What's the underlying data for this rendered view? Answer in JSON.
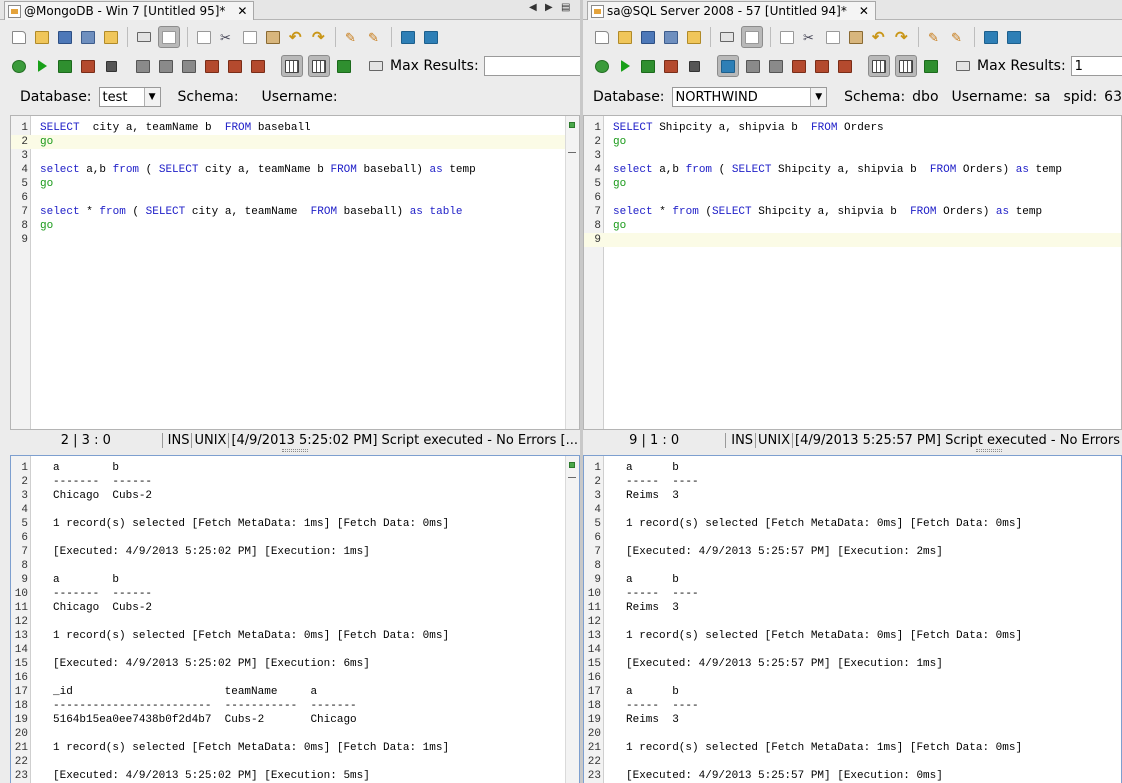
{
  "left": {
    "tab_title": "@MongoDB - Win 7 [Untitled 95]*",
    "tab_close": "✕",
    "max_results_label": "Max Results:",
    "max_results_value": "",
    "database_label": "Database:",
    "database_value": "test",
    "schema_label": "Schema:",
    "username_label": "Username:",
    "editor_lines": [
      {
        "n": "1",
        "parts": [
          [
            "kw",
            "SELECT"
          ],
          [
            "",
            "  city a, teamName b  "
          ],
          [
            "kw",
            "FROM"
          ],
          [
            "",
            " baseball"
          ]
        ]
      },
      {
        "n": "2",
        "parts": [
          [
            "go",
            "go"
          ]
        ]
      },
      {
        "n": "3",
        "parts": []
      },
      {
        "n": "4",
        "parts": [
          [
            "kw",
            "select"
          ],
          [
            "",
            " a,b "
          ],
          [
            "kw",
            "from"
          ],
          [
            "",
            " ( "
          ],
          [
            "kw",
            "SELECT"
          ],
          [
            "",
            " city a, teamName b "
          ],
          [
            "kw",
            "FROM"
          ],
          [
            "",
            " baseball) "
          ],
          [
            "kw",
            "as"
          ],
          [
            "",
            " temp"
          ]
        ]
      },
      {
        "n": "5",
        "parts": [
          [
            "go",
            "go"
          ]
        ]
      },
      {
        "n": "6",
        "parts": []
      },
      {
        "n": "7",
        "parts": [
          [
            "kw",
            "select"
          ],
          [
            "",
            " * "
          ],
          [
            "kw",
            "from"
          ],
          [
            "",
            " ( "
          ],
          [
            "kw",
            "SELECT"
          ],
          [
            "",
            " city a, teamName  "
          ],
          [
            "kw",
            "FROM"
          ],
          [
            "",
            " baseball) "
          ],
          [
            "kw",
            "as"
          ],
          [
            "",
            " "
          ],
          [
            "kw",
            "table"
          ]
        ]
      },
      {
        "n": "8",
        "parts": [
          [
            "go",
            "go"
          ]
        ]
      },
      {
        "n": "9",
        "parts": []
      }
    ],
    "status_pos": "2 | 3 : 0",
    "status_ins": "INS",
    "status_unix": "UNIX",
    "status_msg": "[4/9/2013 5:25:02 PM] Script executed - No Errors [...",
    "output_lines": [
      [
        "1",
        "a        b"
      ],
      [
        "2",
        "-------  ------"
      ],
      [
        "3",
        "Chicago  Cubs-2"
      ],
      [
        "4",
        ""
      ],
      [
        "5",
        "1 record(s) selected [Fetch MetaData: 1ms] [Fetch Data: 0ms]"
      ],
      [
        "6",
        ""
      ],
      [
        "7",
        "[Executed: 4/9/2013 5:25:02 PM] [Execution: 1ms]"
      ],
      [
        "8",
        ""
      ],
      [
        "9",
        "a        b"
      ],
      [
        "10",
        "-------  ------"
      ],
      [
        "11",
        "Chicago  Cubs-2"
      ],
      [
        "12",
        ""
      ],
      [
        "13",
        "1 record(s) selected [Fetch MetaData: 0ms] [Fetch Data: 0ms]"
      ],
      [
        "14",
        ""
      ],
      [
        "15",
        "[Executed: 4/9/2013 5:25:02 PM] [Execution: 6ms]"
      ],
      [
        "16",
        ""
      ],
      [
        "17",
        "_id                       teamName     a"
      ],
      [
        "18",
        "------------------------  -----------  -------"
      ],
      [
        "19",
        "5164b15ea0ee7438b0f2d4b7  Cubs-2       Chicago"
      ],
      [
        "20",
        ""
      ],
      [
        "21",
        "1 record(s) selected [Fetch MetaData: 0ms] [Fetch Data: 1ms]"
      ],
      [
        "22",
        ""
      ],
      [
        "23",
        "[Executed: 4/9/2013 5:25:02 PM] [Execution: 5ms]"
      ],
      [
        "24",
        ""
      ]
    ]
  },
  "right": {
    "tab_title": "sa@SQL Server 2008 - 57 [Untitled 94]*",
    "tab_close": "✕",
    "max_results_label": "Max Results:",
    "max_results_value": "1",
    "database_label": "Database:",
    "database_value": "NORTHWIND",
    "schema_label": "Schema:",
    "schema_value": "dbo",
    "username_label": "Username:",
    "username_value": "sa",
    "spid_label": "spid:",
    "spid_value": "63",
    "editor_lines": [
      {
        "n": "1",
        "parts": [
          [
            "kw",
            "SELECT"
          ],
          [
            "",
            " Shipcity a, shipvia b  "
          ],
          [
            "kw",
            "FROM"
          ],
          [
            "",
            " Orders"
          ]
        ]
      },
      {
        "n": "2",
        "parts": [
          [
            "go",
            "go"
          ]
        ]
      },
      {
        "n": "3",
        "parts": []
      },
      {
        "n": "4",
        "parts": [
          [
            "kw",
            "select"
          ],
          [
            "",
            " a,b "
          ],
          [
            "kw",
            "from"
          ],
          [
            "",
            " ( "
          ],
          [
            "kw",
            "SELECT"
          ],
          [
            "",
            " Shipcity a, shipvia b  "
          ],
          [
            "kw",
            "FROM"
          ],
          [
            "",
            " Orders) "
          ],
          [
            "kw",
            "as"
          ],
          [
            "",
            " temp"
          ]
        ]
      },
      {
        "n": "5",
        "parts": [
          [
            "go",
            "go"
          ]
        ]
      },
      {
        "n": "6",
        "parts": []
      },
      {
        "n": "7",
        "parts": [
          [
            "kw",
            "select"
          ],
          [
            "",
            " * "
          ],
          [
            "kw",
            "from"
          ],
          [
            "",
            " ("
          ],
          [
            "kw",
            "SELECT"
          ],
          [
            "",
            " Shipcity a, shipvia b  "
          ],
          [
            "kw",
            "FROM"
          ],
          [
            "",
            " Orders) "
          ],
          [
            "kw",
            "as"
          ],
          [
            "",
            " temp"
          ]
        ]
      },
      {
        "n": "8",
        "parts": [
          [
            "go",
            "go"
          ]
        ]
      },
      {
        "n": "9",
        "parts": []
      }
    ],
    "status_pos": "9 | 1 : 0",
    "status_ins": "INS",
    "status_unix": "UNIX",
    "status_msg": "[4/9/2013 5:25:57 PM] Script executed - No Errors",
    "output_lines": [
      [
        "1",
        "a      b"
      ],
      [
        "2",
        "-----  ----"
      ],
      [
        "3",
        "Reims  3"
      ],
      [
        "4",
        ""
      ],
      [
        "5",
        "1 record(s) selected [Fetch MetaData: 0ms] [Fetch Data: 0ms]"
      ],
      [
        "6",
        ""
      ],
      [
        "7",
        "[Executed: 4/9/2013 5:25:57 PM] [Execution: 2ms]"
      ],
      [
        "8",
        ""
      ],
      [
        "9",
        "a      b"
      ],
      [
        "10",
        "-----  ----"
      ],
      [
        "11",
        "Reims  3"
      ],
      [
        "12",
        ""
      ],
      [
        "13",
        "1 record(s) selected [Fetch MetaData: 0ms] [Fetch Data: 0ms]"
      ],
      [
        "14",
        ""
      ],
      [
        "15",
        "[Executed: 4/9/2013 5:25:57 PM] [Execution: 1ms]"
      ],
      [
        "16",
        ""
      ],
      [
        "17",
        "a      b"
      ],
      [
        "18",
        "-----  ----"
      ],
      [
        "19",
        "Reims  3"
      ],
      [
        "20",
        ""
      ],
      [
        "21",
        "1 record(s) selected [Fetch MetaData: 1ms] [Fetch Data: 0ms]"
      ],
      [
        "22",
        ""
      ],
      [
        "23",
        "[Executed: 4/9/2013 5:25:57 PM] [Execution: 0ms]"
      ],
      [
        "24",
        ""
      ]
    ]
  },
  "icons": {
    "tab_nav": [
      "◀",
      "▶",
      "▤"
    ],
    "toolbar1": [
      "new-doc-icon",
      "open-folder-icon",
      "save-icon",
      "save-as-icon",
      "save-all-icon",
      "print-icon",
      "toggle-editor-icon",
      "select-icon",
      "cut-icon",
      "copy-icon",
      "paste-icon",
      "undo-icon",
      "redo-icon",
      "format-icon",
      "auto-format-icon",
      "replace-icon",
      "find-replace-icon"
    ],
    "toolbar2": [
      "execute-script-icon",
      "run-icon",
      "execute-explain-icon",
      "execute-grid-icon",
      "stop-icon",
      "history-prev-icon",
      "history-back-icon",
      "history-forward-icon",
      "history-last-icon",
      "commit-icon",
      "rollback-icon",
      "tab-results-icon",
      "grid-results-icon",
      "text-results-icon",
      "export-icon"
    ]
  }
}
